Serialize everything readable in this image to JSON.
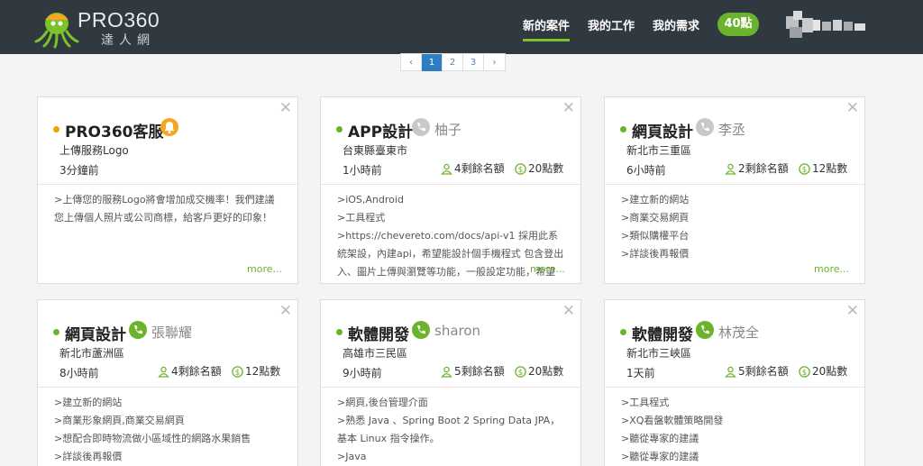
{
  "logo": {
    "name": "PRO360",
    "subtitle": "達人網"
  },
  "nav": {
    "new_cases": "新的案件",
    "my_jobs": "我的工作",
    "my_requests": "我的需求"
  },
  "points_badge": "40點",
  "pagination": {
    "prev": "‹",
    "pages": [
      "1",
      "2",
      "3"
    ],
    "next": "›",
    "current": "1"
  },
  "colors": {
    "accent": "#6cb32d",
    "topbar": "#303840",
    "page_active": "#2f7dc3",
    "alert": "#f0a000"
  },
  "cards": [
    {
      "title": "PRO360客服",
      "contact": "",
      "contact_icon": "bell-icon",
      "location": "上傳服務Logo",
      "time": "3分鐘前",
      "slots": "",
      "points": "",
      "body": [
        ">上傳您的服務Logo將會增加成交機率！我們建議您上傳個人照片或公司商標，給客戶更好的印象！"
      ],
      "more": "more..."
    },
    {
      "title": "APP設計",
      "contact": "柚子",
      "contact_icon": "phone-icon",
      "location": "台東縣臺東市",
      "time": "1小時前",
      "slots": "4剩餘名額",
      "points": "20點數",
      "body": [
        ">iOS,Android",
        ">工具程式",
        ">https://chevereto.com/docs/api-v1 採用此系統架設，內建api，希望能設計個手機程式 包含登出入、圖片上傳與瀏覽等功能，一般設定功能，希望"
      ],
      "more": "more..."
    },
    {
      "title": "網頁設計",
      "contact": "李丞",
      "contact_icon": "phone-icon",
      "location": "新北市三重區",
      "time": "6小時前",
      "slots": "2剩餘名額",
      "points": "12點數",
      "body": [
        ">建立新的網站",
        ">商業交易網頁",
        ">類似購權平台",
        ">詳談後再報價"
      ],
      "more": "more..."
    },
    {
      "title": "網頁設計",
      "contact": "張聯耀",
      "contact_icon": "phone-icon",
      "location": "新北市蘆洲區",
      "time": "8小時前",
      "slots": "4剩餘名額",
      "points": "12點數",
      "body": [
        ">建立新的網站",
        ">商業形象網頁,商業交易網頁",
        ">想配合即時物流做小區域性的網路水果銷售",
        ">詳談後再報價"
      ],
      "more": ""
    },
    {
      "title": "軟體開發",
      "contact": "sharon",
      "contact_icon": "phone-icon",
      "location": "高雄市三民區",
      "time": "9小時前",
      "slots": "5剩餘名額",
      "points": "20點數",
      "body": [
        ">網頁,後台管理介面",
        ">熟悉 Java 、Spring Boot 2 Spring Data JPA，基本 Linux 指令操作。",
        ">Java"
      ],
      "more": ""
    },
    {
      "title": "軟體開發",
      "contact": "林茂全",
      "contact_icon": "phone-icon",
      "location": "新北市三峽區",
      "time": "1天前",
      "slots": "5剩餘名額",
      "points": "20點數",
      "body": [
        ">工具程式",
        ">XQ看盤軟體策略開發",
        ">聽從專家的建議",
        ">聽從專家的建議"
      ],
      "more": ""
    }
  ]
}
